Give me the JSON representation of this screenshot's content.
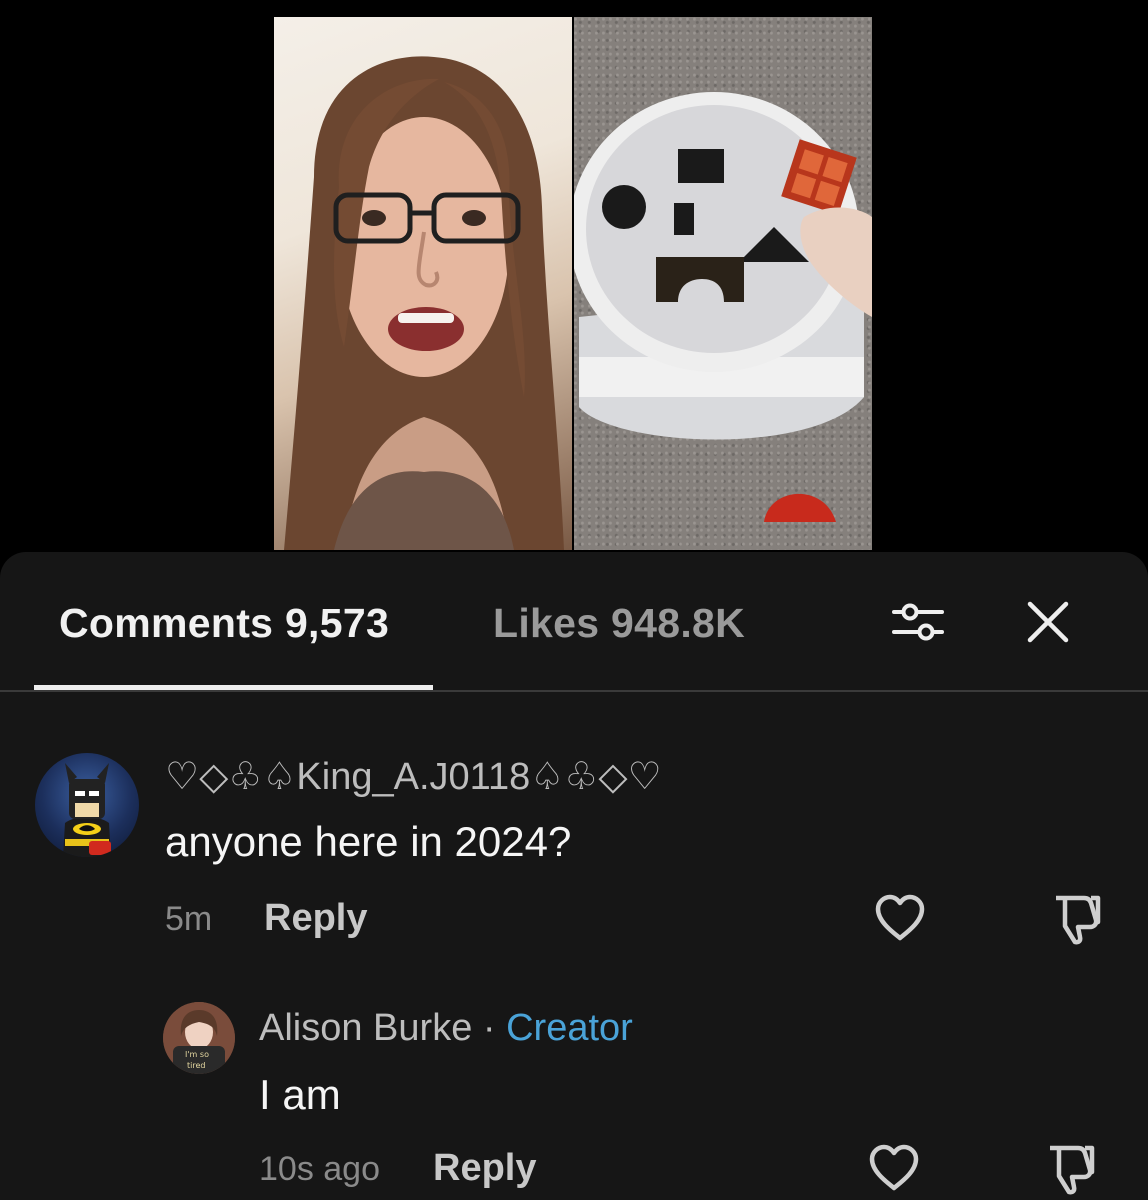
{
  "tabs": {
    "comments_label": "Comments 9,573",
    "likes_label": "Likes 948.8K"
  },
  "icons": {
    "filter": "sliders-icon",
    "close": "close-icon",
    "like": "heart-outline-icon",
    "dislike": "thumbs-down-icon"
  },
  "comments": [
    {
      "username": "♡◇♧♤King_A.J0118♤♧◇♡",
      "text": "anyone here in 2024?",
      "time": "5m",
      "reply_label": "Reply"
    },
    {
      "username": "Alison Burke",
      "separator": "·",
      "badge": "Creator",
      "text": "I am",
      "time": "10s ago",
      "reply_label": "Reply"
    }
  ],
  "avatar_text": {
    "line1": "I'm so",
    "line2": "tired"
  },
  "colors": {
    "sheet_background": "#161616",
    "creator_badge": "#4aa3d8",
    "active_tab": "#f1f1f1",
    "inactive_tab": "#9a9a9a"
  }
}
